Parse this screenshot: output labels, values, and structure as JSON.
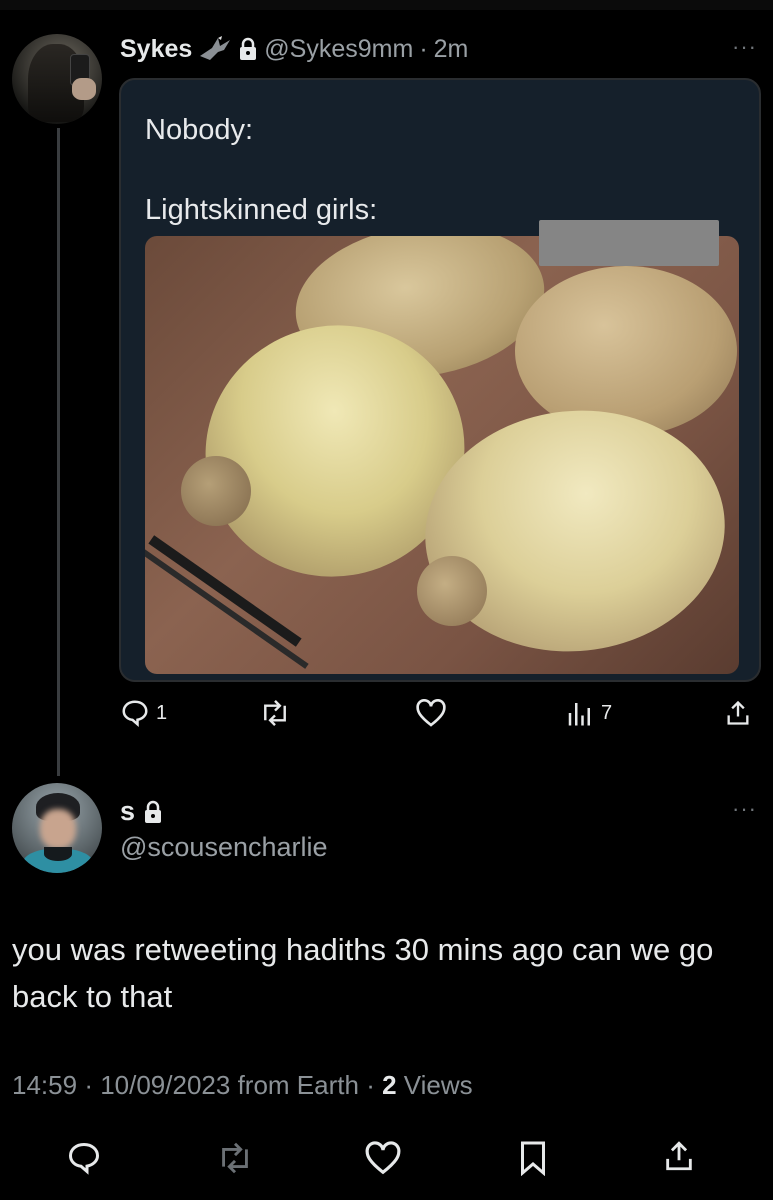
{
  "original_tweet": {
    "display_name": "Sykes",
    "handle": "@Sykes9mm",
    "time": "2m",
    "more_label": "···",
    "media": {
      "caption_line_1": "Nobody:",
      "caption_line_2": "Lightskinned girls:"
    },
    "actions": {
      "reply_count": "1",
      "retweet_count": "",
      "like_count": "",
      "views_count": "7"
    }
  },
  "reply_tweet": {
    "display_name": "s",
    "handle": "@scousencharlie",
    "more_label": "···",
    "text": "you was retweeting hadiths 30 mins ago can we go back to that",
    "time": "14:59",
    "date": "10/09/2023",
    "source": "from Earth",
    "views_count": "2",
    "views_label": "Views"
  },
  "colors": {
    "background": "#000000",
    "text_primary": "#e7e9ea",
    "text_secondary": "#9aa0a5",
    "media_background": "#15202b"
  }
}
